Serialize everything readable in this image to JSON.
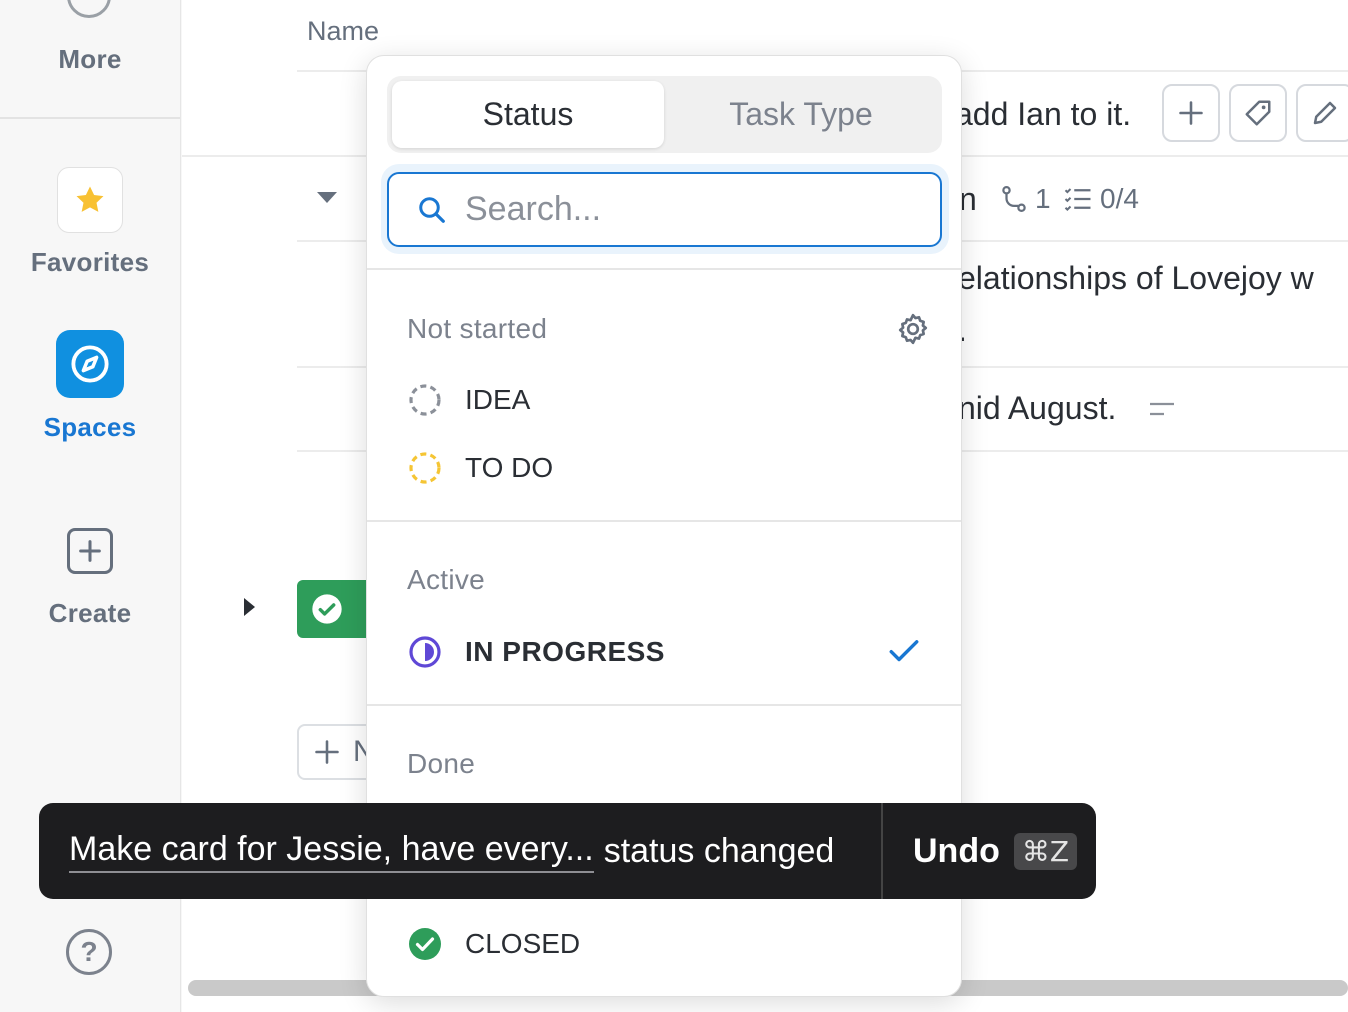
{
  "sidebar": {
    "more_label": "More",
    "favorites_label": "Favorites",
    "spaces_label": "Spaces",
    "create_label": "Create",
    "help_glyph": "?",
    "colors": {
      "spaces_active": "#1090e0",
      "favorite_star": "#f8c133"
    }
  },
  "table": {
    "name_header": "Name",
    "rows": [
      {
        "text": "add Ian to it."
      },
      {
        "text": "n",
        "subtasks_count": "1",
        "checklist": "0/4"
      },
      {
        "text": "elationships of Lovejoy w",
        "continuation": "."
      },
      {
        "text": "nid August."
      }
    ],
    "new_partial": "N"
  },
  "dropdown": {
    "tabs": [
      {
        "label": "Status",
        "active": true
      },
      {
        "label": "Task Type",
        "active": false
      }
    ],
    "search_placeholder": "Search...",
    "groups": {
      "not_started": {
        "label": "Not started",
        "items": [
          "IDEA",
          "TO DO"
        ]
      },
      "active": {
        "label": "Active",
        "items": [
          "IN PROGRESS"
        ],
        "selected": "IN PROGRESS"
      },
      "done": {
        "label": "Done"
      },
      "closed_item": "CLOSED"
    },
    "colors": {
      "idea": "#8b9099",
      "todo": "#f5c534",
      "in_progress": "#5f48d6",
      "closed": "#2e9d5a",
      "check": "#1977d2"
    }
  },
  "toast": {
    "task_name": "Make card for Jessie, have every...",
    "message": "status changed",
    "undo_label": "Undo",
    "shortcut": "⌘Z"
  }
}
